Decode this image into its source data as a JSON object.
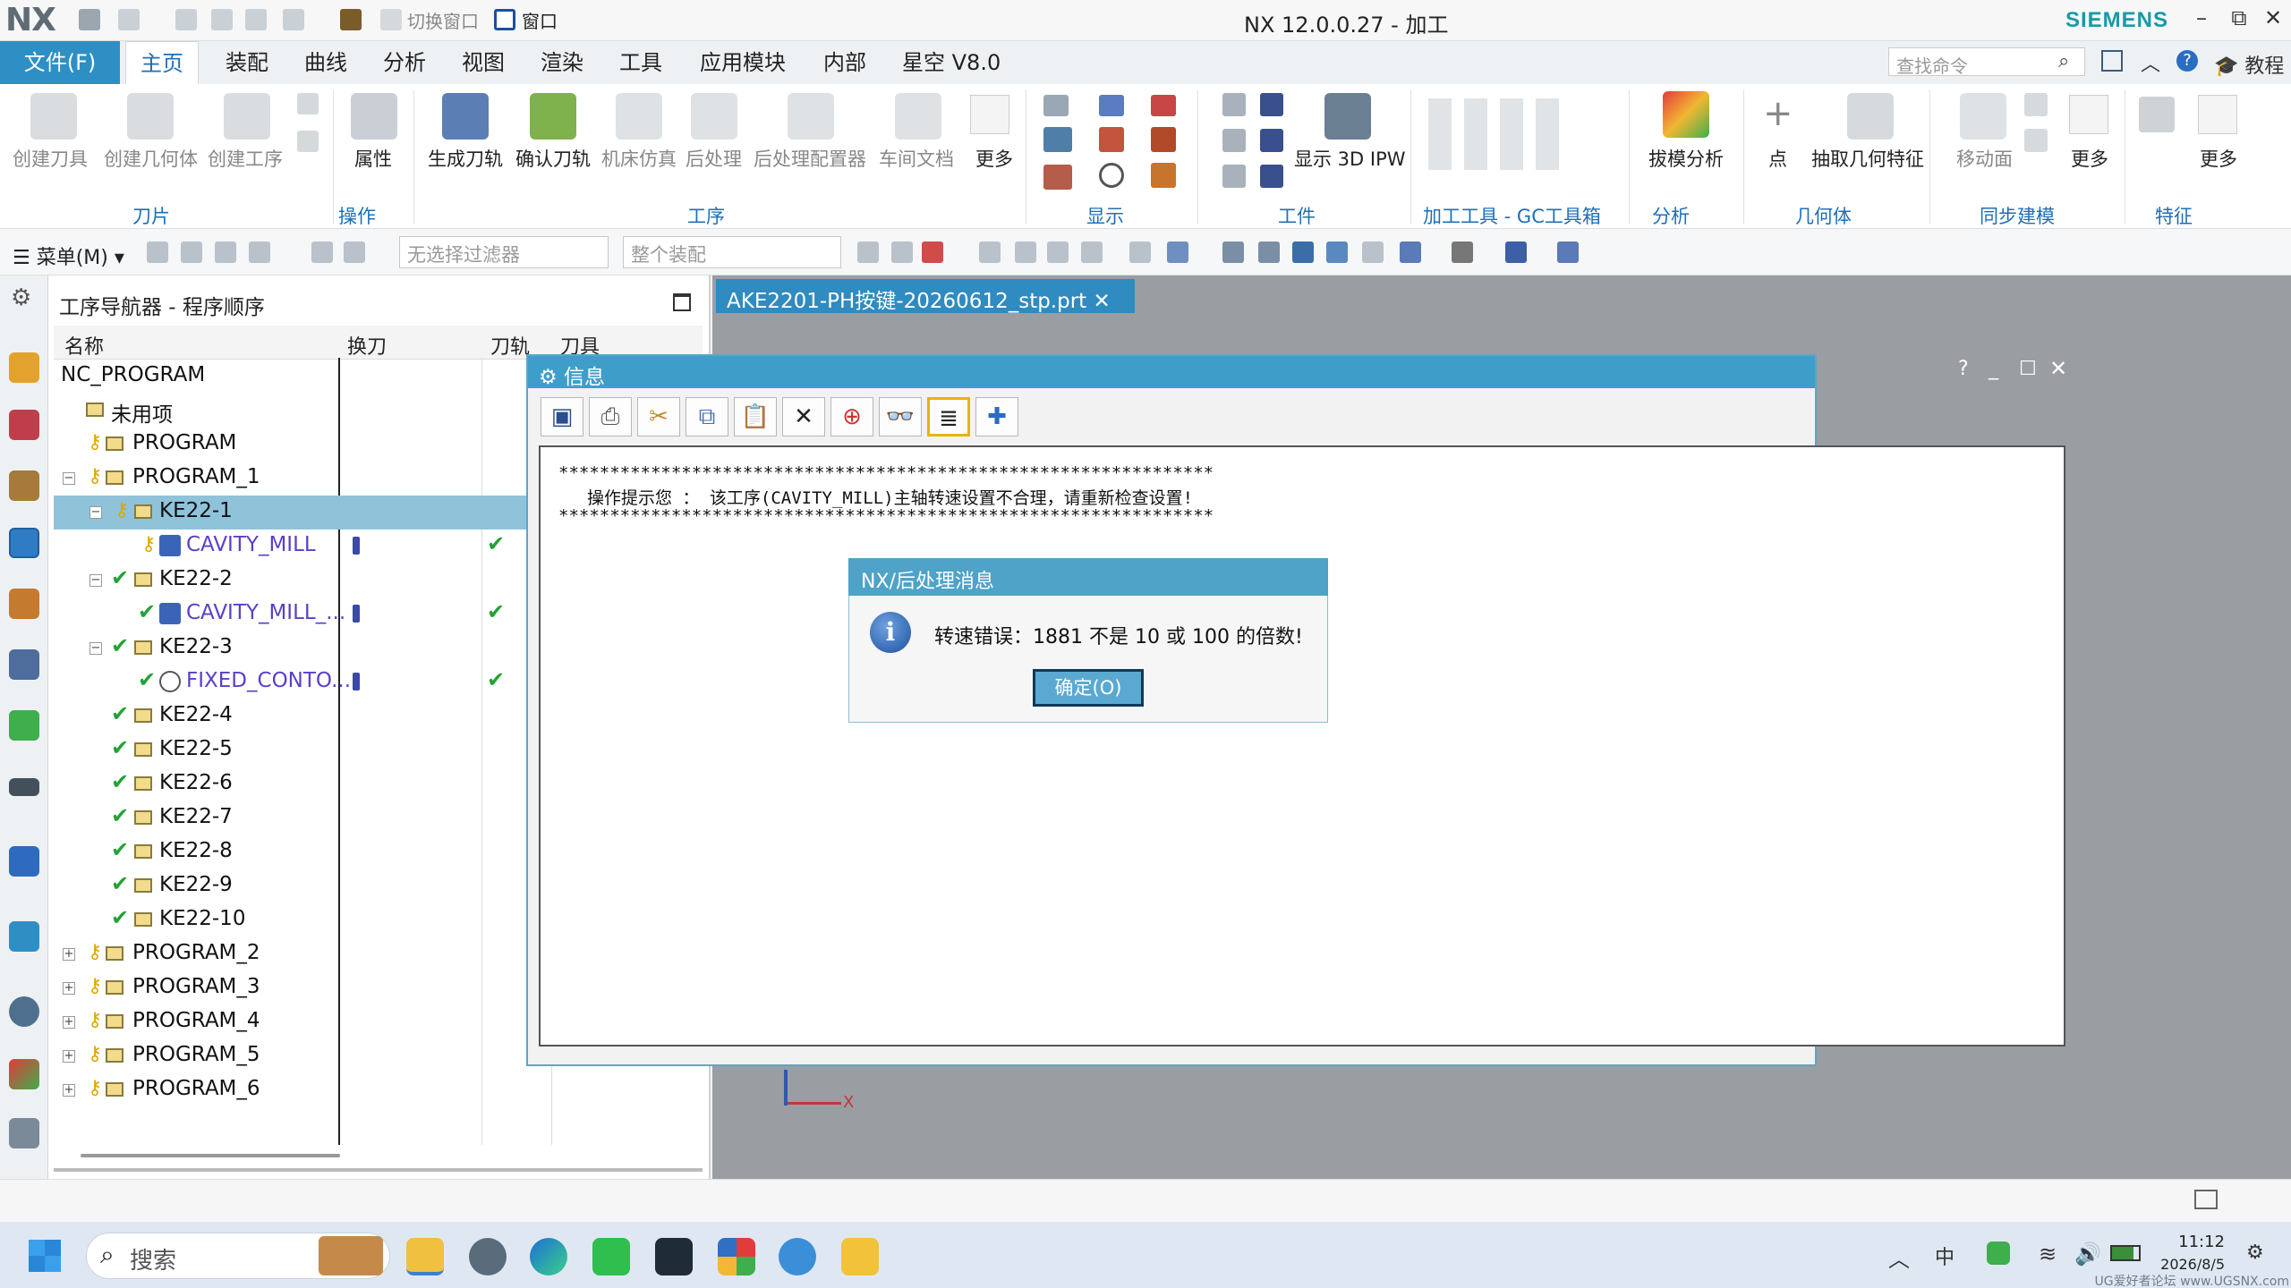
{
  "window": {
    "logo": "NX",
    "title": "NX 12.0.0.27 - 加工",
    "brand": "SIEMENS",
    "qa_switch": "切换窗口",
    "qa_window": "窗口",
    "min": "–",
    "restore": "⧉",
    "close": "✕"
  },
  "menu": {
    "file": "文件(F)",
    "tabs": [
      "主页",
      "装配",
      "曲线",
      "分析",
      "视图",
      "渲染",
      "工具",
      "应用模块",
      "内部",
      "星空 V8.0"
    ],
    "search_placeholder": "查找命令",
    "tutorial": "教程"
  },
  "ribbon": {
    "buttons": [
      {
        "label": "创建刀具",
        "enabled": false
      },
      {
        "label": "创建几何体",
        "enabled": false
      },
      {
        "label": "创建工序",
        "enabled": false
      },
      {
        "label": "属性",
        "enabled": true
      },
      {
        "label": "生成刀轨",
        "enabled": true
      },
      {
        "label": "确认刀轨",
        "enabled": true
      },
      {
        "label": "机床仿真",
        "enabled": false
      },
      {
        "label": "后处理",
        "enabled": false
      },
      {
        "label": "后处理配置器",
        "enabled": false
      },
      {
        "label": "车间文档",
        "enabled": false
      },
      {
        "label": "更多",
        "enabled": true
      },
      {
        "label": "显示 3D IPW",
        "enabled": true
      },
      {
        "label": "拔模分析",
        "enabled": true
      },
      {
        "label": "点",
        "enabled": true
      },
      {
        "label": "抽取几何特征",
        "enabled": true
      },
      {
        "label": "移动面",
        "enabled": false
      },
      {
        "label": "更多",
        "enabled": true
      },
      {
        "label": "更多",
        "enabled": true
      }
    ],
    "groups": [
      "刀片",
      "操作",
      "工序",
      "显示",
      "工件",
      "加工工具 - GC工具箱",
      "分析",
      "几何体",
      "同步建模",
      "特征"
    ]
  },
  "toolbar2": {
    "menu": "菜单(M)",
    "filter": "无选择过滤器",
    "assembly": "整个装配"
  },
  "navigator": {
    "title": "工序导航器 - 程序顺序",
    "columns": [
      "名称",
      "换刀",
      "刀轨",
      "刀具"
    ],
    "rows": [
      {
        "name": "NC_PROGRAM",
        "level": 0
      },
      {
        "name": "未用项",
        "level": 1
      },
      {
        "name": "PROGRAM",
        "level": 1
      },
      {
        "name": "PROGRAM_1",
        "level": 1
      },
      {
        "name": "KE22-1",
        "level": 2
      },
      {
        "name": "CAVITY_MILL",
        "level": 3
      },
      {
        "name": "KE22-2",
        "level": 2
      },
      {
        "name": "CAVITY_MILL_...",
        "level": 3
      },
      {
        "name": "KE22-3",
        "level": 2
      },
      {
        "name": "FIXED_CONTO...",
        "level": 3
      },
      {
        "name": "KE22-4",
        "level": 2
      },
      {
        "name": "KE22-5",
        "level": 2
      },
      {
        "name": "KE22-6",
        "level": 2
      },
      {
        "name": "KE22-7",
        "level": 2
      },
      {
        "name": "KE22-8",
        "level": 2
      },
      {
        "name": "KE22-9",
        "level": 2
      },
      {
        "name": "KE22-10",
        "level": 2
      },
      {
        "name": "PROGRAM_2",
        "level": 1
      },
      {
        "name": "PROGRAM_3",
        "level": 1
      },
      {
        "name": "PROGRAM_4",
        "level": 1
      },
      {
        "name": "PROGRAM_5",
        "level": 1
      },
      {
        "name": "PROGRAM_6",
        "level": 1
      }
    ]
  },
  "part_tab": "AKE2201-PH按键-20260612_stp.prt",
  "info_dialog": {
    "title": "信息",
    "stars": "****************************************************************",
    "message": "操作提示您 ： 该工序(CAVITY_MILL)主轴转速设置不合理，请重新检查设置!"
  },
  "msg_dialog": {
    "title": "NX/后处理消息",
    "text": "转速错误：1881 不是 10 或 100 的倍数!",
    "ok": "确定(O)"
  },
  "axis_label": "X",
  "taskbar": {
    "search": "搜索",
    "ime": "中",
    "time": "11:12",
    "date": "2026/8/5",
    "watermark": "UG爱好者论坛 www.UGSNX.com"
  }
}
